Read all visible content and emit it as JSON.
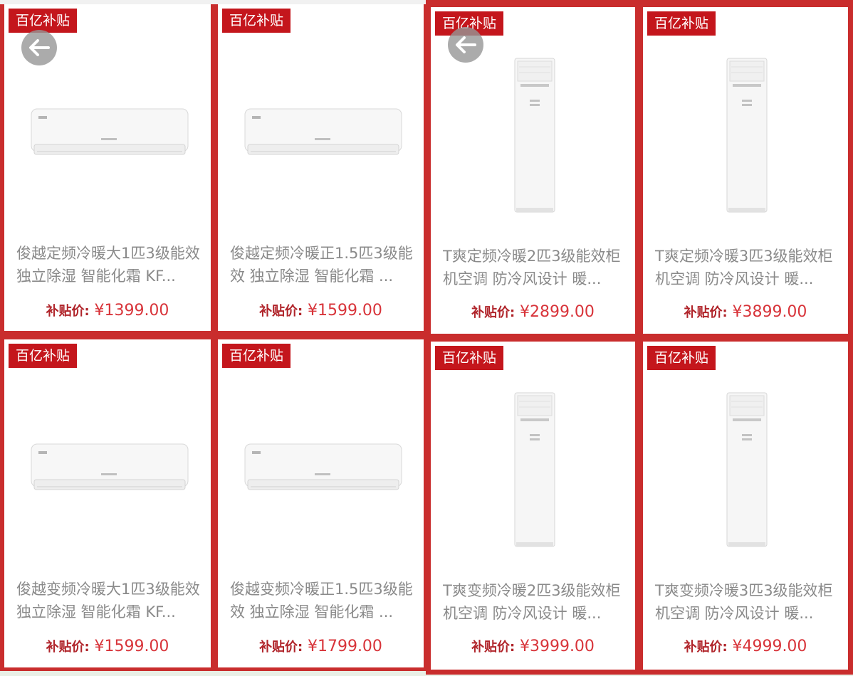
{
  "colors": {
    "accent": "#c92d2d",
    "badge": "#c4161c",
    "price": "#d8343a"
  },
  "icons": {
    "back": "arrow-left-icon"
  },
  "products": [
    {
      "badge": "百亿补贴",
      "title": "俊越定频冷暖大1匹3级能效 独立除湿 智能化霜 KF...",
      "price_label": "补贴价:",
      "price": "¥1399.00",
      "image": "wall-mounted-ac"
    },
    {
      "badge": "百亿补贴",
      "title": "俊越定频冷暖正1.5匹3级能效 独立除湿 智能化霜 ...",
      "price_label": "补贴价:",
      "price": "¥1599.00",
      "image": "wall-mounted-ac"
    },
    {
      "badge": "百亿补贴",
      "title": "俊越变频冷暖大1匹3级能效 独立除湿 智能化霜 KF...",
      "price_label": "补贴价:",
      "price": "¥1599.00",
      "image": "wall-mounted-ac"
    },
    {
      "badge": "百亿补贴",
      "title": "俊越变频冷暖正1.5匹3级能效 独立除湿 智能化霜 ...",
      "price_label": "补贴价:",
      "price": "¥1799.00",
      "image": "wall-mounted-ac"
    },
    {
      "badge": "百亿补贴",
      "title": "T爽定频冷暖2匹3级能效柜机空调 防冷风设计 暖...",
      "price_label": "补贴价:",
      "price": "¥2899.00",
      "image": "floor-standing-ac"
    },
    {
      "badge": "百亿补贴",
      "title": "T爽定频冷暖3匹3级能效柜机空调 防冷风设计 暖...",
      "price_label": "补贴价:",
      "price": "¥3899.00",
      "image": "floor-standing-ac"
    },
    {
      "badge": "百亿补贴",
      "title": "T爽变频冷暖2匹3级能效柜机空调 防冷风设计 暖...",
      "price_label": "补贴价:",
      "price": "¥3999.00",
      "image": "floor-standing-ac"
    },
    {
      "badge": "百亿补贴",
      "title": "T爽变频冷暖3匹3级能效柜机空调 防冷风设计 暖...",
      "price_label": "补贴价:",
      "price": "¥4999.00",
      "image": "floor-standing-ac"
    }
  ]
}
